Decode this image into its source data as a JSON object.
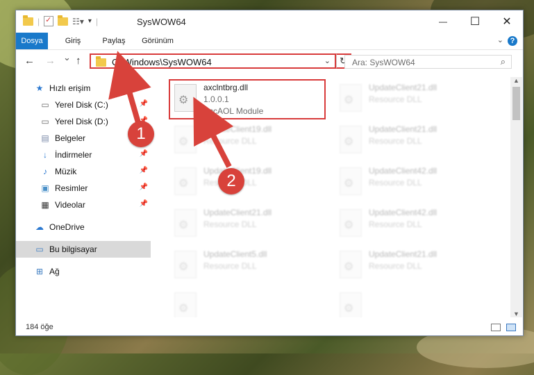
{
  "window": {
    "title": "SysWOW64",
    "minimize": "—",
    "maximize": "☐",
    "close": "✕"
  },
  "ribbon": {
    "tabs": [
      "Dosya",
      "Giriş",
      "Paylaş",
      "Görünüm"
    ],
    "help": "?"
  },
  "nav": {
    "back": "←",
    "forward": "→",
    "recent": "⌄",
    "up": "↑",
    "address": "C:\\Windows\\SysWOW64",
    "refresh": "↻",
    "search_placeholder": "Ara: SysWOW64"
  },
  "sidebar": {
    "items": [
      {
        "label": "Hızlı erişim",
        "icon": "star-icon"
      },
      {
        "label": "Yerel Disk (C:)",
        "icon": "drive-icon"
      },
      {
        "label": "Yerel Disk (D:)",
        "icon": "drive-icon"
      },
      {
        "label": "Belgeler",
        "icon": "documents-icon"
      },
      {
        "label": "İndirmeler",
        "icon": "download-icon"
      },
      {
        "label": "Müzik",
        "icon": "music-icon"
      },
      {
        "label": "Resimler",
        "icon": "pictures-icon"
      },
      {
        "label": "Videolar",
        "icon": "videos-icon"
      },
      {
        "label": "OneDrive",
        "icon": "cloud-icon"
      },
      {
        "label": "Bu bilgisayar",
        "icon": "computer-icon"
      },
      {
        "label": "Ağ",
        "icon": "network-icon"
      }
    ]
  },
  "files": [
    {
      "name": "axclntbrg.dll",
      "version": "1.0.0.1",
      "description": "AccAOL Module"
    },
    {
      "name": "UpdateClient21.dll",
      "description": "Resource DLL"
    },
    {
      "name": "UpdateClient19.dll",
      "description": "Resource DLL"
    },
    {
      "name": "UpdateClient21.dll",
      "description": "Resource DLL"
    },
    {
      "name": "UpdateClient19.dll",
      "description": "Resource DLL"
    },
    {
      "name": "UpdateClient42.dll",
      "description": "Resource DLL"
    },
    {
      "name": "UpdateClient21.dll",
      "description": "Resource DLL"
    },
    {
      "name": "UpdateClient42.dll",
      "description": "Resource DLL"
    },
    {
      "name": "UpdateClient5.dll",
      "description": "Resource DLL"
    },
    {
      "name": "UpdateClient21.dll",
      "description": "Resource DLL"
    }
  ],
  "status": {
    "count": "184 öğe"
  },
  "callouts": [
    "1",
    "2"
  ],
  "colors": {
    "accent": "#1979ca",
    "highlight": "#d83a3a"
  }
}
